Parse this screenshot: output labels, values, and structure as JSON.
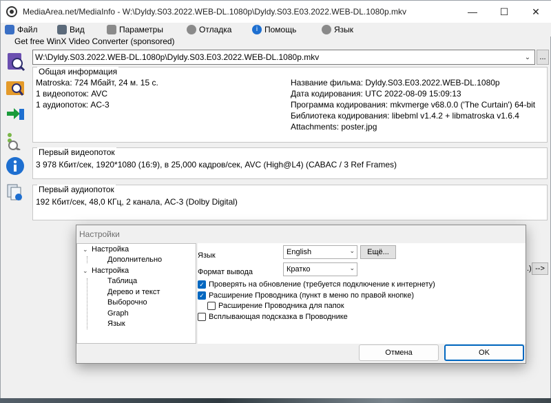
{
  "window": {
    "title": "MediaArea.net/MediaInfo - W:\\Dyldy.S03.2022.WEB-DL.1080p\\Dyldy.S03.E03.2022.WEB-DL.1080p.mkv",
    "controls": {
      "minimize": "—",
      "maximize": "☐",
      "close": "✕"
    }
  },
  "menubar": {
    "items": [
      {
        "label": "Файл",
        "icon": "file-icon",
        "color": "#3a6fc4"
      },
      {
        "label": "Вид",
        "icon": "view-icon",
        "color": "#5b6a7a"
      },
      {
        "label": "Параметры",
        "icon": "settings-icon",
        "color": "#6d6d6d"
      },
      {
        "label": "Отладка",
        "icon": "debug-icon",
        "color": "#6d6d6d"
      },
      {
        "label": "Помощь",
        "icon": "help-icon",
        "color": "#1e6fd0"
      },
      {
        "label": "Язык",
        "icon": "language-icon",
        "color": "#6d6d6d"
      }
    ]
  },
  "sponsor": {
    "text": "Get free WinX Video Converter (sponsored)"
  },
  "path": {
    "value": "W:\\Dyldy.S03.2022.WEB-DL.1080p\\Dyldy.S03.E03.2022.WEB-DL.1080p.mkv",
    "browse_label": "..."
  },
  "sidebar": {
    "buttons": [
      "open-file-icon",
      "open-folder-icon",
      "export-icon",
      "debug-tree-icon",
      "info-icon",
      "multi-file-icon"
    ]
  },
  "general": {
    "heading": "Общая информация",
    "left": [
      "Matroska: 724 Мбайт, 24 м. 15 с.",
      "1 видеопоток: AVC",
      "1 аудиопоток: AC-3"
    ],
    "right": [
      "Название фильма: Dyldy.S03.E03.2022.WEB-DL.1080p",
      "Дата кодирования: UTC 2022-08-09 15:09:13",
      "Программа кодирования: mkvmerge v68.0.0 ('The Curtain') 64-bit",
      "Библиотека кодирования: libebml v1.4.2 + libmatroska v1.6.4",
      "Attachments: poster.jpg"
    ]
  },
  "video": {
    "heading": "Первый видеопоток",
    "line": "3 978 Кбит/сек, 1920*1080 (16:9), в 25,000 кадров/сек, AVC (High@L4) (CABAC / 3 Ref Frames)"
  },
  "audio": {
    "heading": "Первый аудиопоток",
    "line": "192 Кбит/сек, 48,0 КГц, 2 канала, AC-3 (Dolby Digital)"
  },
  "behind": {
    "partial_text": ".)",
    "next_label": "-->"
  },
  "settings_dialog": {
    "title": "Настройки",
    "tree": [
      {
        "label": "Настройка",
        "expander": "⌄",
        "level": 0
      },
      {
        "label": "Дополнительно",
        "level": 1
      },
      {
        "label": "Настройка",
        "expander": "⌄",
        "level": 0
      },
      {
        "label": "Таблица",
        "level": 1
      },
      {
        "label": "Дерево и текст",
        "level": 1
      },
      {
        "label": "Выборочно",
        "level": 1
      },
      {
        "label": "Graph",
        "level": 1
      },
      {
        "label": "Язык",
        "level": 1
      }
    ],
    "language_label": "Язык",
    "language_value": "English",
    "more_button": "Ещё...",
    "output_format_label": "Формат вывода",
    "output_format_value": "Кратко",
    "checkboxes": [
      {
        "label": "Проверять на обновление (требуется подключение к интернету)",
        "checked": true
      },
      {
        "label": "Расширение Проводника (пункт в меню по правой кнопке)",
        "checked": true
      },
      {
        "label": "Расширение Проводника для папок",
        "checked": false
      },
      {
        "label": "Всплывающая подсказка в Проводнике",
        "checked": false
      }
    ],
    "cancel_button": "Отмена",
    "ok_button": "OK",
    "accent_color": "#0067c0"
  }
}
